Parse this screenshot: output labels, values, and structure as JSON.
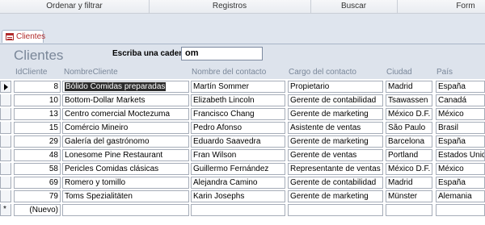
{
  "ribbon": {
    "groups": [
      "Ordenar y filtrar",
      "Registros",
      "Buscar",
      "Form"
    ]
  },
  "tab": {
    "label": "Clientes",
    "icon": "form-icon"
  },
  "form": {
    "title": "Clientes",
    "filter_label": "Escriba una cadena",
    "filter_value": "om"
  },
  "columns": [
    "IdCliente",
    "NombreCliente",
    "Nombre del contacto",
    "Cargo del contacto",
    "Ciudad",
    "País"
  ],
  "rows": [
    {
      "id": "8",
      "nombre": "Bólido Comidas preparadas",
      "contacto": "Martín Sommer",
      "cargo": "Propietario",
      "ciudad": "Madrid",
      "pais": "España"
    },
    {
      "id": "10",
      "nombre": "Bottom-Dollar Markets",
      "contacto": "Elizabeth Lincoln",
      "cargo": "Gerente de contabilidad",
      "ciudad": "Tsawassen",
      "pais": "Canadá"
    },
    {
      "id": "13",
      "nombre": "Centro comercial Moctezuma",
      "contacto": "Francisco Chang",
      "cargo": "Gerente de marketing",
      "ciudad": "México D.F.",
      "pais": "México"
    },
    {
      "id": "15",
      "nombre": "Comércio Mineiro",
      "contacto": "Pedro Afonso",
      "cargo": "Asistente de ventas",
      "ciudad": "São Paulo",
      "pais": "Brasil"
    },
    {
      "id": "29",
      "nombre": "Galería del gastrónomo",
      "contacto": "Eduardo Saavedra",
      "cargo": "Gerente de marketing",
      "ciudad": "Barcelona",
      "pais": "España"
    },
    {
      "id": "48",
      "nombre": "Lonesome Pine Restaurant",
      "contacto": "Fran Wilson",
      "cargo": "Gerente de ventas",
      "ciudad": "Portland",
      "pais": "Estados Unidos"
    },
    {
      "id": "58",
      "nombre": "Pericles Comidas clásicas",
      "contacto": "Guillermo Fernández",
      "cargo": "Representante de ventas",
      "ciudad": "México D.F.",
      "pais": "México"
    },
    {
      "id": "69",
      "nombre": "Romero y tomillo",
      "contacto": "Alejandra Camino",
      "cargo": "Gerente de contabilidad",
      "ciudad": "Madrid",
      "pais": "España"
    },
    {
      "id": "79",
      "nombre": "Toms Spezialitäten",
      "contacto": "Karin Josephs",
      "cargo": "Gerente de marketing",
      "ciudad": "Münster",
      "pais": "Alemania"
    }
  ],
  "new_record": {
    "id": "(Nuevo)"
  },
  "colors": {
    "accent": "#b02a2a",
    "header_bg": "#dde3ec",
    "title": "#7a8799"
  }
}
